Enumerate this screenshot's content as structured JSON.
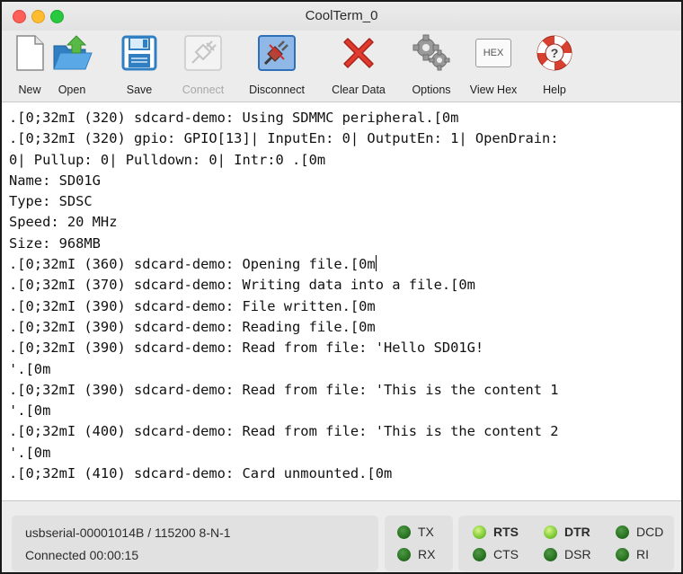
{
  "window": {
    "title": "CoolTerm_0"
  },
  "toolbar": {
    "new": "New",
    "open": "Open",
    "save": "Save",
    "connect": "Connect",
    "disconnect": "Disconnect",
    "clear_data": "Clear Data",
    "options": "Options",
    "view_hex": "View Hex",
    "view_hex_icon_text": "HEX",
    "help": "Help"
  },
  "icons": {
    "new": "new-document-icon",
    "open": "open-folder-icon",
    "save": "floppy-disk-icon",
    "connect": "plug-connect-icon",
    "disconnect": "plug-disconnect-icon",
    "clear_data": "red-x-icon",
    "options": "gears-icon",
    "view_hex": "hex-icon",
    "help": "lifebuoy-help-icon"
  },
  "terminal": {
    "lines": [
      ".[0;32mI (320) sdcard-demo: Using SDMMC peripheral.[0m",
      ".[0;32mI (320) gpio: GPIO[13]| InputEn: 0| OutputEn: 1| OpenDrain:",
      "0| Pullup: 0| Pulldown: 0| Intr:0 .[0m",
      "Name: SD01G",
      "Type: SDSC",
      "Speed: 20 MHz",
      "Size: 968MB",
      ".[0;32mI (360) sdcard-demo: Opening file.[0m",
      ".[0;32mI (370) sdcard-demo: Writing data into a file.[0m",
      ".[0;32mI (390) sdcard-demo: File written.[0m",
      ".[0;32mI (390) sdcard-demo: Reading file.[0m",
      ".[0;32mI (390) sdcard-demo: Read from file: 'Hello SD01G!",
      "'.[0m",
      ".[0;32mI (390) sdcard-demo: Read from file: 'This is the content 1",
      "'.[0m",
      ".[0;32mI (400) sdcard-demo: Read from file: 'This is the content 2",
      "'.[0m",
      ".[0;32mI (410) sdcard-demo: Card unmounted.[0m"
    ]
  },
  "status": {
    "port": "usbserial-00001014B / 115200 8-N-1",
    "connected": "Connected 00:00:15",
    "tx": "TX",
    "rx": "RX",
    "rts": "RTS",
    "cts": "CTS",
    "dtr": "DTR",
    "dsr": "DSR",
    "dcd": "DCD",
    "ri": "RI"
  },
  "colors": {
    "led_off": "#2e7d27",
    "led_on": "#8ed13f",
    "clear_x": "#e03a2f",
    "help_ring": "#d8412f"
  }
}
